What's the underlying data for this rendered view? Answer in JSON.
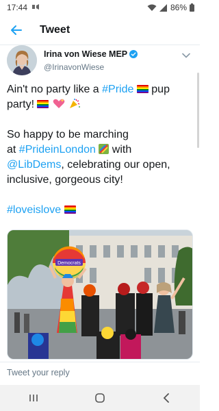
{
  "status_bar": {
    "time": "17:44",
    "battery": "86%"
  },
  "header": {
    "title": "Tweet"
  },
  "tweet": {
    "author_name": "Irina von Wiese MEP",
    "author_handle": "@IrinavonWiese",
    "text": {
      "l1_a": "Ain't no party like a ",
      "l1_tag": "#Pride",
      "l1_b": " pup",
      "l2": "party!",
      "l4": "So happy to be marching",
      "l5_a": "at ",
      "l5_tag": "#PrideinLondon",
      "l5_b": " with",
      "l6_mention": "@LibDems",
      "l6_b": ", celebrating our open,",
      "l7": "inclusive, gorgeous city!",
      "l9_tag": "#loveislove"
    },
    "photo_sign": "Democrats"
  },
  "reply": {
    "placeholder": "Tweet your reply"
  },
  "icons": {
    "back": "back-arrow-icon",
    "verified": "verified-badge-icon",
    "more": "chevron-down-icon",
    "nav_recent": "recent-apps-icon",
    "nav_home": "home-icon",
    "nav_back": "nav-back-icon"
  },
  "colors": {
    "accent": "#1da1f2",
    "text": "#14171a",
    "secondary": "#657786"
  }
}
